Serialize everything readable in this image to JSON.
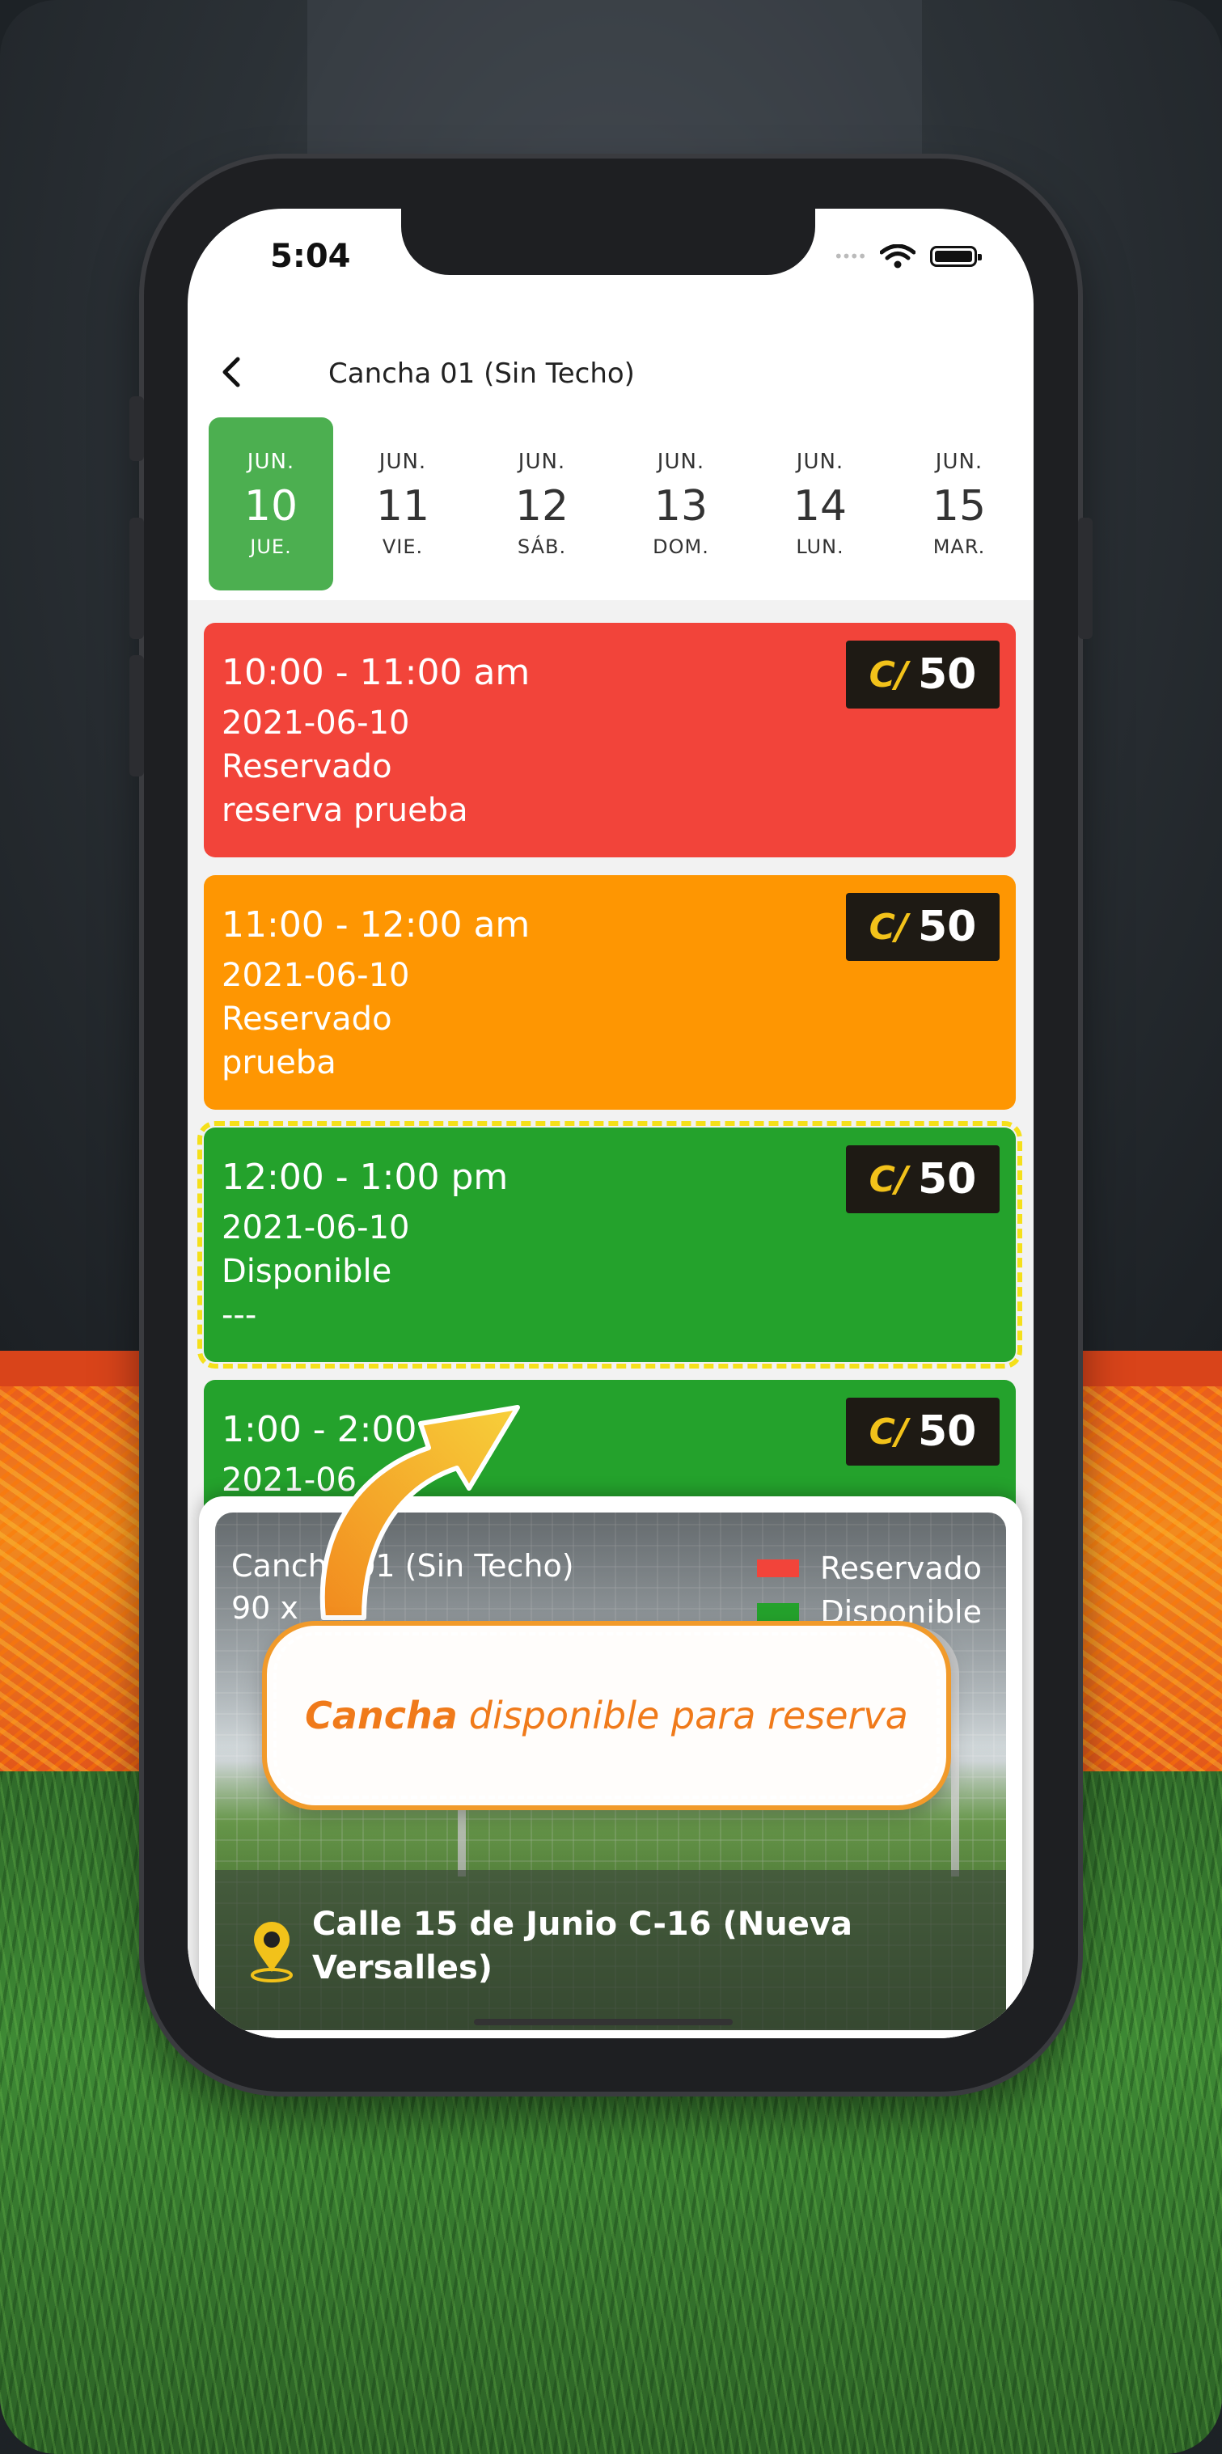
{
  "status": {
    "time": "5:04"
  },
  "nav": {
    "title": "Cancha 01 (Sin Techo)"
  },
  "days": [
    {
      "month": "JUN.",
      "day": "10",
      "weekday": "JUE.",
      "selected": true
    },
    {
      "month": "JUN.",
      "day": "11",
      "weekday": "VIE.",
      "selected": false
    },
    {
      "month": "JUN.",
      "day": "12",
      "weekday": "SÁB.",
      "selected": false
    },
    {
      "month": "JUN.",
      "day": "13",
      "weekday": "DOM.",
      "selected": false
    },
    {
      "month": "JUN.",
      "day": "14",
      "weekday": "LUN.",
      "selected": false
    },
    {
      "month": "JUN.",
      "day": "15",
      "weekday": "MAR.",
      "selected": false
    }
  ],
  "slots": [
    {
      "time": "10:00 - 11:00 am",
      "date": "2021-06-10",
      "status": "Reservado",
      "note": "reserva prueba",
      "price_logo": "C/",
      "price": "50",
      "color": "#f2443a"
    },
    {
      "time": "11:00 - 12:00 am",
      "date": "2021-06-10",
      "status": "Reservado",
      "note": "prueba",
      "price_logo": "C/",
      "price": "50",
      "color": "#fe9602"
    },
    {
      "time": "12:00 - 1:00 pm",
      "date": "2021-06-10",
      "status": "Disponible",
      "note": "---",
      "price_logo": "C/",
      "price": "50",
      "color": "#24a22c"
    },
    {
      "time": "1:00 - 2:00",
      "date": "2021-06",
      "price_logo": "C/",
      "price": "50",
      "color": "#24a22c"
    }
  ],
  "card": {
    "name": "Cancha 01 (Sin Techo)",
    "size": "90 x",
    "legend": [
      {
        "label": "Reservado",
        "color": "#f2443a"
      },
      {
        "label": "Disponible",
        "color": "#24a22c"
      }
    ],
    "address": "Calle 15 de Junio C-16 (Nueva Versalles)",
    "address_icon": "location-pin-icon"
  },
  "callout": {
    "bold": "Cancha",
    "rest": "disponible para reserva"
  },
  "colors": {
    "accent": "#f07a1a",
    "selected_day": "#4caf50",
    "highlight": "#f5e01a"
  }
}
